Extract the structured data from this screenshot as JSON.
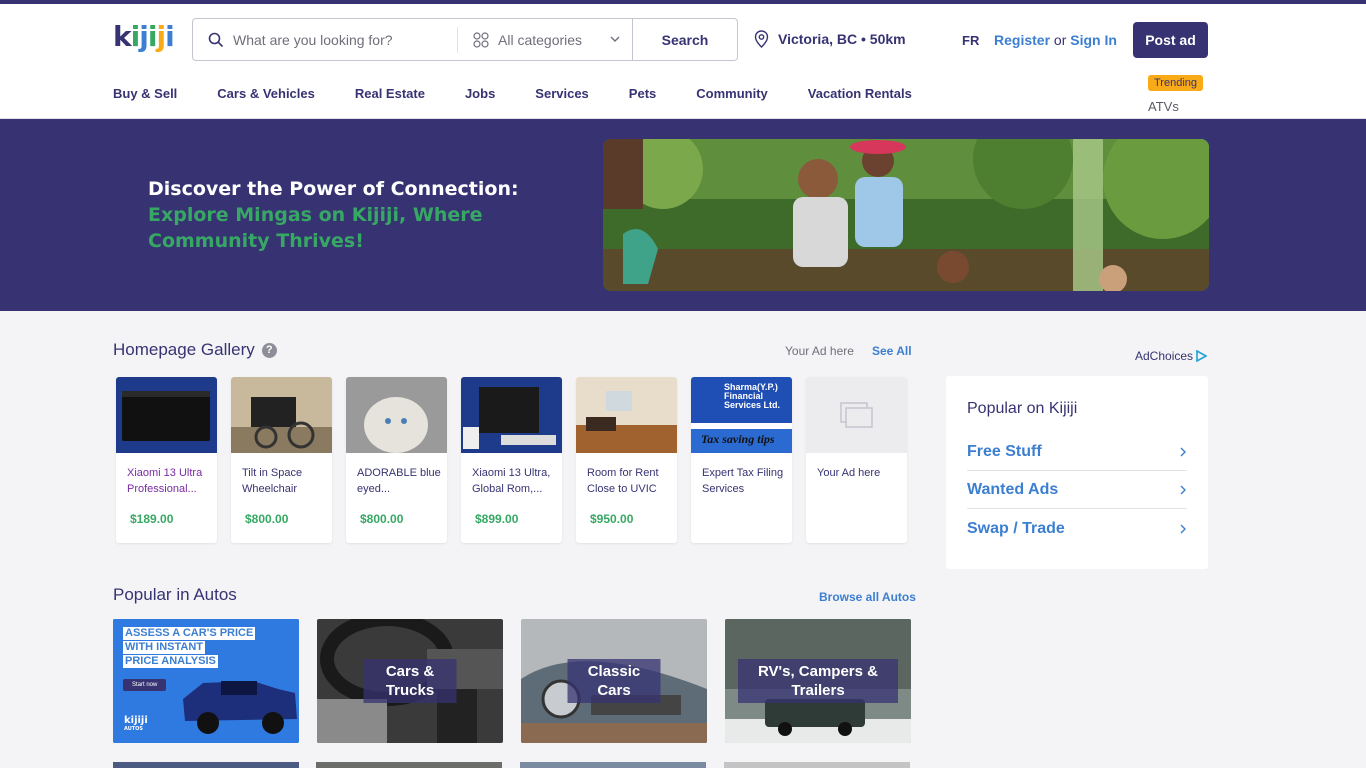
{
  "header": {
    "logo": "kijiji",
    "search_placeholder": "What are you looking for?",
    "category": "All categories",
    "search_label": "Search",
    "location": "Victoria, BC • 50km",
    "lang": "FR",
    "register": "Register",
    "or": "or",
    "sign_in": "Sign In",
    "post_ad": "Post ad",
    "trending_badge": "Trending",
    "trending_item": "ATVs"
  },
  "nav": [
    "Buy & Sell",
    "Cars & Vehicles",
    "Real Estate",
    "Jobs",
    "Services",
    "Pets",
    "Community",
    "Vacation Rentals"
  ],
  "hero": {
    "line1": "Discover the Power of Connection:",
    "line2": "Explore Mingas on Kijiji, Where Community Thrives!"
  },
  "gallery": {
    "title": "Homepage Gallery",
    "your_ad_link": "Your Ad here",
    "see_all": "See All",
    "items": [
      {
        "title": "Xiaomi 13 Ultra Professional...",
        "price": "$189.00"
      },
      {
        "title": "Tilt in Space Wheelchair",
        "price": "$800.00"
      },
      {
        "title": "ADORABLE blue eyed...",
        "price": "$800.00"
      },
      {
        "title": "Xiaomi 13 Ultra, Global Rom,...",
        "price": "$899.00"
      },
      {
        "title": "Room for Rent Close to UVIC",
        "price": "$950.00"
      },
      {
        "title": "Expert Tax Filing Services",
        "price": ""
      },
      {
        "title": "Your Ad here",
        "price": ""
      }
    ],
    "thumb_text": {
      "tax_company": "Sharma(Y.P.) Financial Services Ltd.",
      "tax_tagline": "Tax saving tips"
    }
  },
  "sidebar": {
    "ad_choices": "AdChoices",
    "popular_title": "Popular on Kijiji",
    "items": [
      "Free Stuff",
      "Wanted Ads",
      "Swap / Trade"
    ]
  },
  "autos": {
    "title": "Popular in Autos",
    "browse": "Browse all Autos",
    "promo": {
      "line1": "ASSESS A CAR'S PRICE",
      "line2": "WITH INSTANT",
      "line3": "PRICE ANALYSIS",
      "button": "Start now",
      "logo": "kijiji",
      "logo_sub": "AUTOS"
    },
    "cards": [
      "Cars & Trucks",
      "Classic Cars",
      "RV's, Campers & Trailers"
    ]
  },
  "colors": {
    "brand": "#373373",
    "link": "#3c7fd1",
    "price": "#37a864",
    "trending": "#f8aa17"
  }
}
